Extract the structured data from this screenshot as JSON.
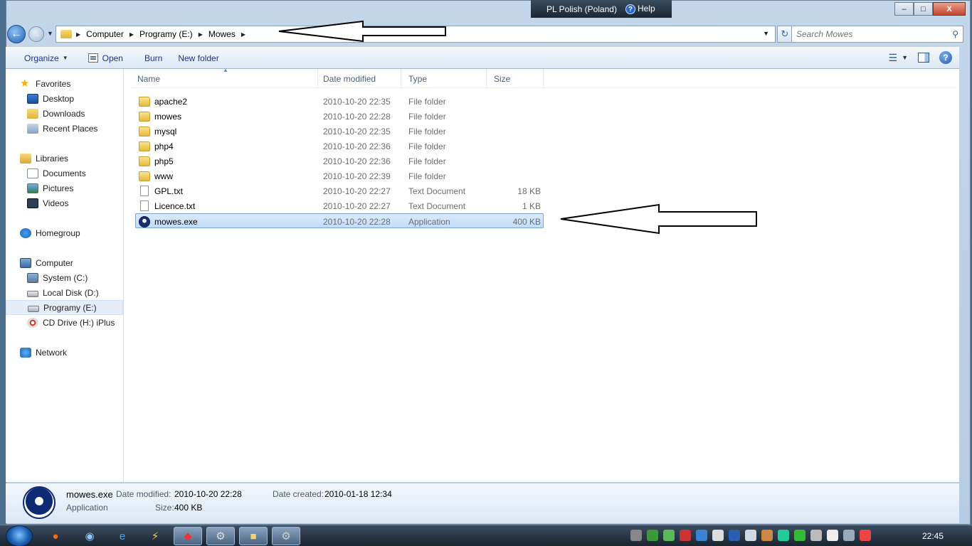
{
  "language_bar": {
    "language": "PL Polish (Poland)",
    "help": "Help"
  },
  "window_controls": {
    "minimize": "–",
    "maximize": "□",
    "close": "X"
  },
  "address_bar": {
    "crumbs": [
      "Computer",
      "Programy (E:)",
      "Mowes"
    ]
  },
  "search": {
    "placeholder": "Search Mowes"
  },
  "toolbar": {
    "organize": "Organize",
    "open": "Open",
    "burn": "Burn",
    "new_folder": "New folder"
  },
  "nav_pane": {
    "favorites": {
      "label": "Favorites",
      "items": [
        "Desktop",
        "Downloads",
        "Recent Places"
      ]
    },
    "libraries": {
      "label": "Libraries",
      "items": [
        "Documents",
        "Pictures",
        "Videos"
      ]
    },
    "homegroup": {
      "label": "Homegroup"
    },
    "computer": {
      "label": "Computer",
      "items": [
        "System (C:)",
        "Local Disk (D:)",
        "Programy (E:)",
        "CD Drive (H:) iPlus"
      ]
    },
    "network": {
      "label": "Network"
    }
  },
  "columns": {
    "name": "Name",
    "date": "Date modified",
    "type": "Type",
    "size": "Size"
  },
  "files": [
    {
      "name": "apache2",
      "date": "2010-10-20 22:35",
      "type": "File folder",
      "size": "",
      "icon": "folder-icon"
    },
    {
      "name": "mowes",
      "date": "2010-10-20 22:28",
      "type": "File folder",
      "size": "",
      "icon": "folder-icon"
    },
    {
      "name": "mysql",
      "date": "2010-10-20 22:35",
      "type": "File folder",
      "size": "",
      "icon": "folder-icon"
    },
    {
      "name": "php4",
      "date": "2010-10-20 22:36",
      "type": "File folder",
      "size": "",
      "icon": "folder-icon"
    },
    {
      "name": "php5",
      "date": "2010-10-20 22:36",
      "type": "File folder",
      "size": "",
      "icon": "folder-icon"
    },
    {
      "name": "www",
      "date": "2010-10-20 22:39",
      "type": "File folder",
      "size": "",
      "icon": "folder-icon"
    },
    {
      "name": "GPL.txt",
      "date": "2010-10-20 22:27",
      "type": "Text Document",
      "size": "18 KB",
      "icon": "text-file-icon"
    },
    {
      "name": "Licence.txt",
      "date": "2010-10-20 22:27",
      "type": "Text Document",
      "size": "1 KB",
      "icon": "text-file-icon"
    },
    {
      "name": "mowes.exe",
      "date": "2010-10-20 22:28",
      "type": "Application",
      "size": "400 KB",
      "icon": "application-icon"
    }
  ],
  "details_pane": {
    "name": "mowes.exe",
    "kind": "Application",
    "date_modified_label": "Date modified:",
    "date_modified": "2010-10-20 22:28",
    "date_created_label": "Date created:",
    "date_created": "2010-01-18 12:34",
    "size_label": "Size:",
    "size": "400 KB"
  },
  "taskbar": {
    "clock": "22:45"
  }
}
